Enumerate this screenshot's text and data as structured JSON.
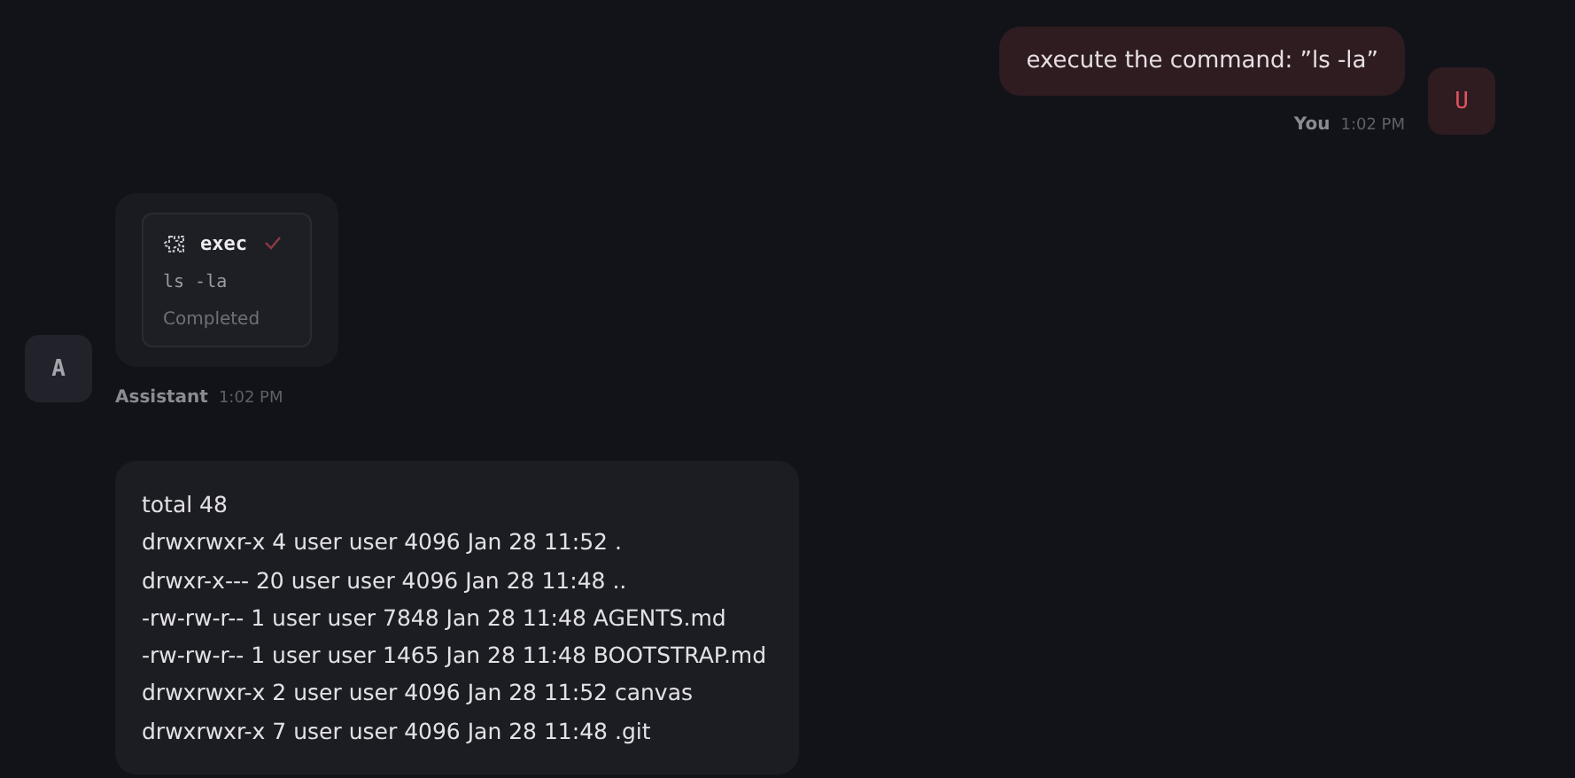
{
  "messages": [
    {
      "kind": "user",
      "avatar": "U",
      "text": "execute the command: ”ls -la”",
      "sender": "You",
      "time": "1:02 PM"
    },
    {
      "kind": "tool",
      "avatar": "A",
      "tool": {
        "name": "exec",
        "succeeded": true,
        "command": "ls -la",
        "status": "Completed"
      },
      "sender": "Assistant",
      "time": "1:02 PM"
    },
    {
      "kind": "output",
      "lines": [
        "total 48",
        "drwxrwxr-x 4 user user 4096 Jan 28 11:52 .",
        "drwxr-x--- 20 user user 4096 Jan 28 11:48 ..",
        "-rw-rw-r-- 1 user user 7848 Jan 28 11:48 AGENTS.md",
        "-rw-rw-r-- 1 user user 1465 Jan 28 11:48 BOOTSTRAP.md",
        "drwxrwxr-x 2 user user 4096 Jan 28 11:52 canvas",
        "drwxrwxr-x 7 user user 4096 Jan 28 11:48 .git"
      ]
    }
  ]
}
